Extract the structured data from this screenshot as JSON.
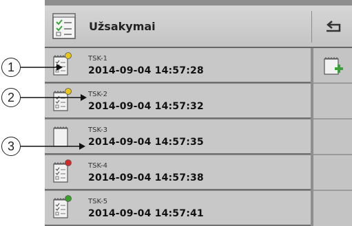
{
  "header": {
    "title": "Užsakymai",
    "icon": "task-list-icon",
    "back_icon": "return-arrow-icon"
  },
  "side": {
    "add_icon": "new-task-icon"
  },
  "tasks": [
    {
      "name": "TSK-1",
      "date": "2014-09-04 14:57:28",
      "status_color": "#e8c516"
    },
    {
      "name": "TSK-2",
      "date": "2014-09-04 14:57:32",
      "status_color": "#e8c516"
    },
    {
      "name": "TSK-3",
      "date": "2014-09-04 14:57:35",
      "status_color": ""
    },
    {
      "name": "TSK-4",
      "date": "2014-09-04 14:57:38",
      "status_color": "#d42a2a"
    },
    {
      "name": "TSK-5",
      "date": "2014-09-04 14:57:41",
      "status_color": "#38a12a"
    }
  ],
  "callouts": [
    "1",
    "2",
    "3"
  ]
}
